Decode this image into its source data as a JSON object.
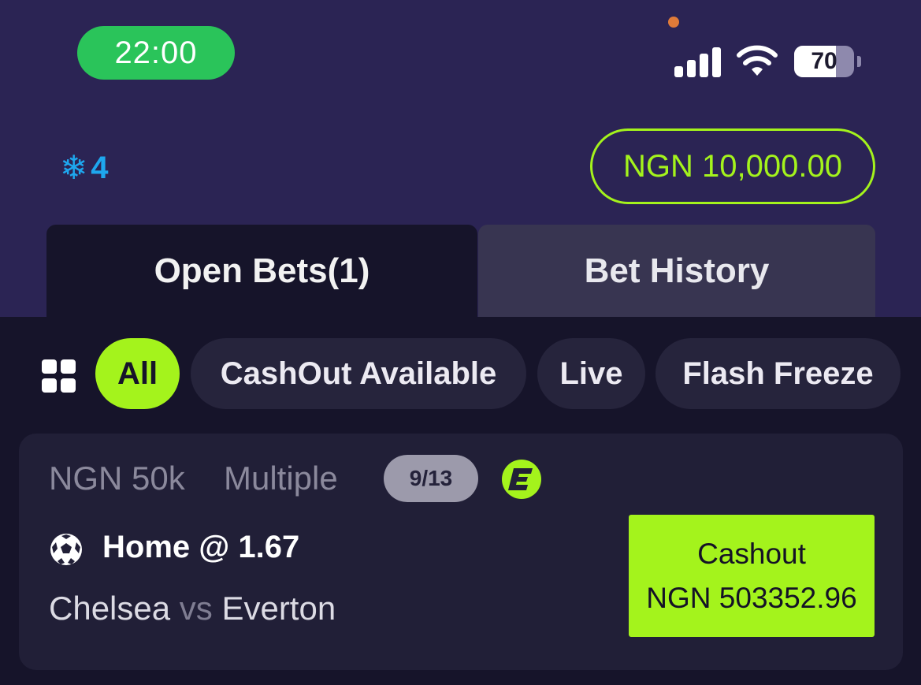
{
  "status_bar": {
    "time": "22:00",
    "battery_level": "70",
    "battery_fraction": 0.7
  },
  "header": {
    "freeze_icon": "snowflake-icon",
    "freeze_count": "4",
    "balance_label": "NGN 10,000.00"
  },
  "tabs": [
    {
      "label": "Open Bets(1)",
      "active": true
    },
    {
      "label": "Bet History",
      "active": false
    }
  ],
  "filters": {
    "grid_icon": "grid-icon",
    "chips": [
      {
        "label": "All",
        "selected": true
      },
      {
        "label": "CashOut Available",
        "selected": false
      },
      {
        "label": "Live",
        "selected": false
      },
      {
        "label": "Flash Freeze",
        "selected": false
      }
    ]
  },
  "bet": {
    "stake": "NGN 50k",
    "type": "Multiple",
    "legs": "9/13",
    "selection": "Home @ 1.67",
    "home_team": "Chelsea",
    "vs": "vs",
    "away_team": "Everton",
    "cashout_label": "Cashout",
    "cashout_amount": "NGN 503352.96"
  },
  "colors": {
    "accent": "#a4f31c",
    "header_bg": "#2b2454",
    "page_bg": "#16142a",
    "time_pill": "#2ac45a",
    "freeze_blue": "#1ea7ee"
  }
}
